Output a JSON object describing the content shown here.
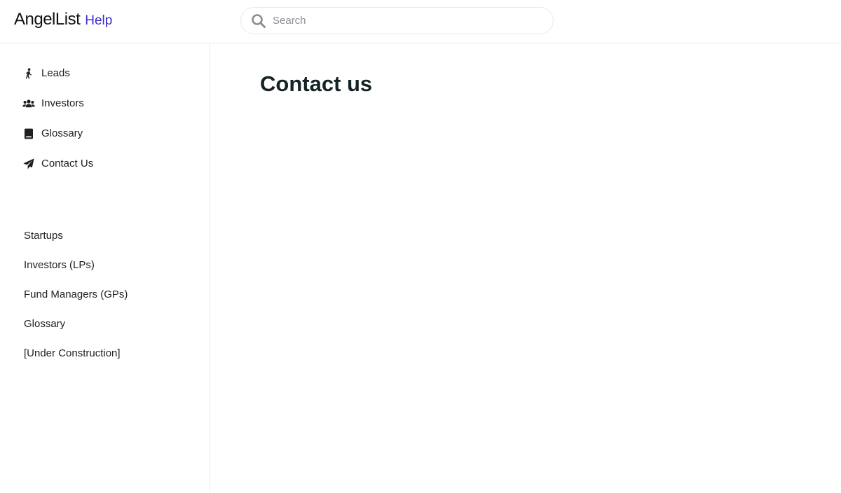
{
  "header": {
    "brand": "AngelList",
    "help": "Help",
    "search": {
      "placeholder": "Search",
      "value": ""
    }
  },
  "sidebar": {
    "primary": [
      {
        "label": "Leads",
        "icon": "walking-person-icon"
      },
      {
        "label": "Investors",
        "icon": "users-group-icon"
      },
      {
        "label": "Glossary",
        "icon": "book-icon"
      },
      {
        "label": "Contact Us",
        "icon": "paper-plane-icon"
      }
    ],
    "secondary": [
      {
        "label": "Startups"
      },
      {
        "label": "Investors (LPs)"
      },
      {
        "label": "Fund Managers (GPs)"
      },
      {
        "label": "Glossary"
      },
      {
        "label": "[Under Construction]"
      }
    ]
  },
  "main": {
    "title": "Contact us"
  },
  "colors": {
    "brand_text": "#0f1112",
    "help_accent": "#3b2fc9",
    "border": "#e9ebee",
    "title": "#162326"
  }
}
